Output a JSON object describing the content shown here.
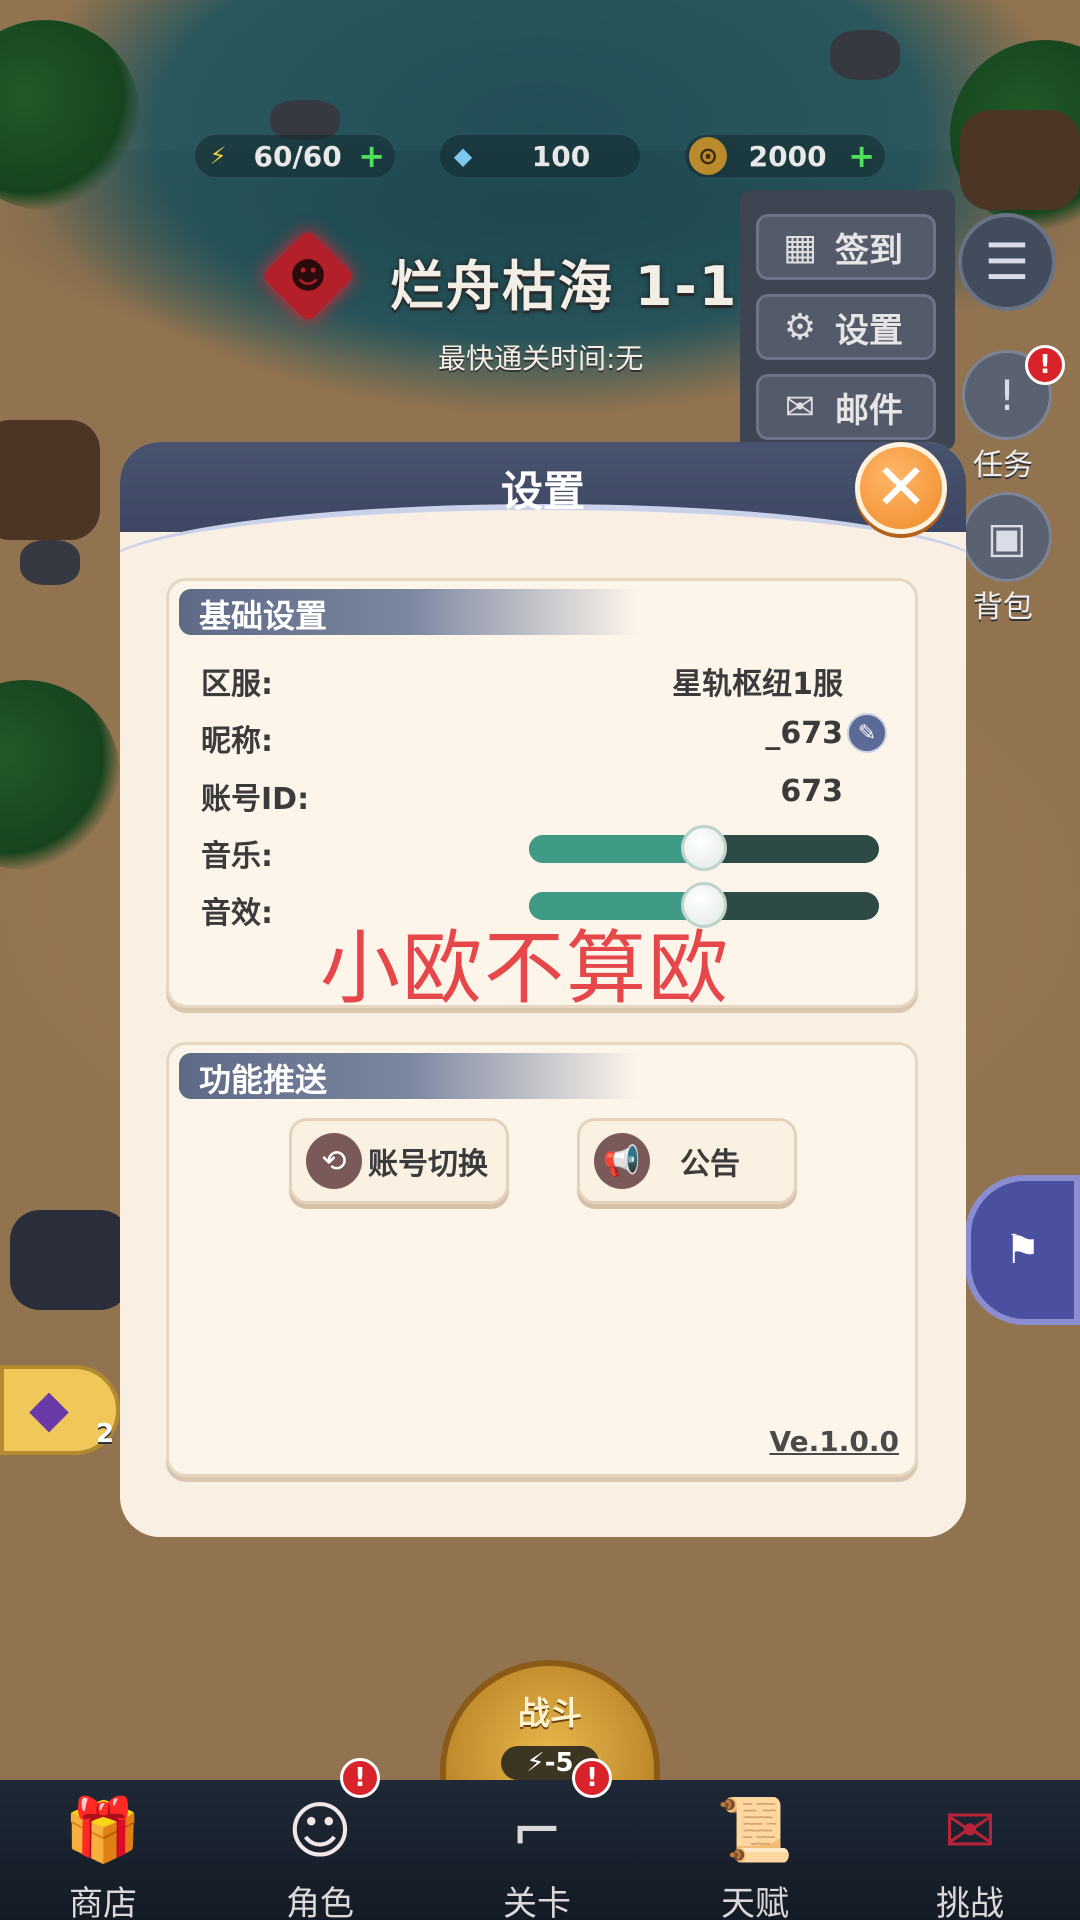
{
  "hud": {
    "energy": "60/60",
    "diamonds": "100",
    "gold": "2000",
    "plus": "+"
  },
  "stage": {
    "title": "烂舟枯海 1-1",
    "subtitle": "最快通关时间:无"
  },
  "side_menu": {
    "items": [
      {
        "label": "签到",
        "icon": "calendar-icon"
      },
      {
        "label": "设置",
        "icon": "gear-icon"
      },
      {
        "label": "邮件",
        "icon": "mail-icon"
      }
    ],
    "tasks_label": "任务",
    "bag_label": "背包",
    "badge": "!"
  },
  "dialog": {
    "title": "设置",
    "close": "✕",
    "basic": {
      "header": "基础设置",
      "server_label": "区服:",
      "server_value": "星轨枢纽1服",
      "nickname_label": "昵称:",
      "nickname_value": "_673",
      "account_label": "账号ID:",
      "account_value": "673",
      "music_label": "音乐:",
      "music_level": 0.5,
      "sfx_label": "音效:",
      "sfx_level": 0.5
    },
    "functions": {
      "header": "功能推送",
      "switch_account": "账号切换",
      "announcement": "公告"
    },
    "version": "Ve.1.0.0"
  },
  "watermark": "小欧不算欧",
  "left_badge": {
    "count": "2"
  },
  "battle": {
    "label": "战斗",
    "cost": "-5"
  },
  "bottom_nav": [
    {
      "label": "商店",
      "icon": "gift-box-icon"
    },
    {
      "label": "角色",
      "icon": "bunny-character-icon"
    },
    {
      "label": "关卡",
      "icon": "rifle-icon"
    },
    {
      "label": "天赋",
      "icon": "scroll-icon"
    },
    {
      "label": "挑战",
      "icon": "rose-envelope-icon"
    }
  ],
  "colors": {
    "slider_fill": "#3f9b86",
    "slider_track": "#2d4a44",
    "close_button": "#f08a2a",
    "header": "#48536e",
    "watermark": "#e5474b"
  }
}
